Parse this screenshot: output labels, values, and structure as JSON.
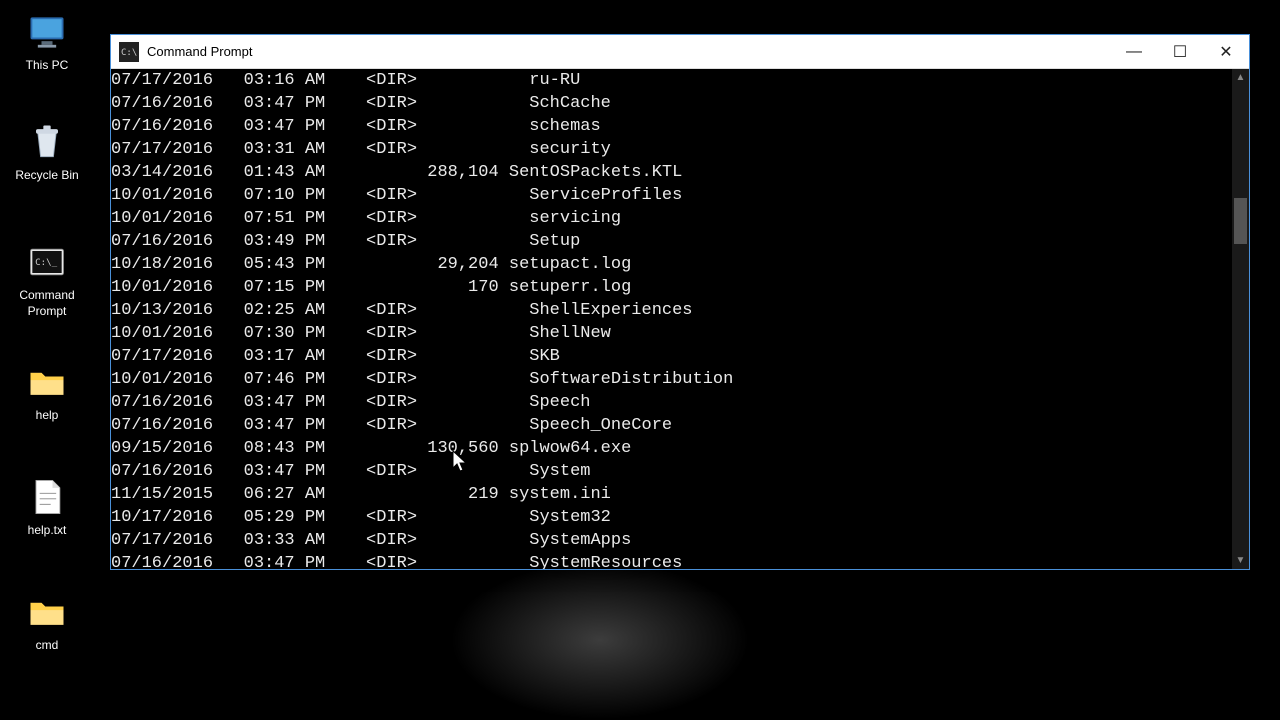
{
  "desktop": {
    "icons": [
      {
        "name": "this-pc",
        "label": "This PC"
      },
      {
        "name": "recycle-bin",
        "label": "Recycle Bin"
      },
      {
        "name": "command-prompt-shortcut",
        "label": "Command Prompt"
      },
      {
        "name": "help-folder",
        "label": "help"
      },
      {
        "name": "help-txt-file",
        "label": "help.txt"
      },
      {
        "name": "cmd-folder",
        "label": "cmd"
      }
    ]
  },
  "window": {
    "title": "Command Prompt",
    "buttons": {
      "min": "—",
      "max": "☐",
      "close": "✕"
    }
  },
  "dir_listing": [
    {
      "date": "07/17/2016",
      "time": "03:16 AM",
      "dir": "<DIR>",
      "size": "",
      "name": "ru-RU"
    },
    {
      "date": "07/16/2016",
      "time": "03:47 PM",
      "dir": "<DIR>",
      "size": "",
      "name": "SchCache"
    },
    {
      "date": "07/16/2016",
      "time": "03:47 PM",
      "dir": "<DIR>",
      "size": "",
      "name": "schemas"
    },
    {
      "date": "07/17/2016",
      "time": "03:31 AM",
      "dir": "<DIR>",
      "size": "",
      "name": "security"
    },
    {
      "date": "03/14/2016",
      "time": "01:43 AM",
      "dir": "",
      "size": "288,104",
      "name": "SentOSPackets.KTL"
    },
    {
      "date": "10/01/2016",
      "time": "07:10 PM",
      "dir": "<DIR>",
      "size": "",
      "name": "ServiceProfiles"
    },
    {
      "date": "10/01/2016",
      "time": "07:51 PM",
      "dir": "<DIR>",
      "size": "",
      "name": "servicing"
    },
    {
      "date": "07/16/2016",
      "time": "03:49 PM",
      "dir": "<DIR>",
      "size": "",
      "name": "Setup"
    },
    {
      "date": "10/18/2016",
      "time": "05:43 PM",
      "dir": "",
      "size": "29,204",
      "name": "setupact.log"
    },
    {
      "date": "10/01/2016",
      "time": "07:15 PM",
      "dir": "",
      "size": "170",
      "name": "setuperr.log"
    },
    {
      "date": "10/13/2016",
      "time": "02:25 AM",
      "dir": "<DIR>",
      "size": "",
      "name": "ShellExperiences"
    },
    {
      "date": "10/01/2016",
      "time": "07:30 PM",
      "dir": "<DIR>",
      "size": "",
      "name": "ShellNew"
    },
    {
      "date": "07/17/2016",
      "time": "03:17 AM",
      "dir": "<DIR>",
      "size": "",
      "name": "SKB"
    },
    {
      "date": "10/01/2016",
      "time": "07:46 PM",
      "dir": "<DIR>",
      "size": "",
      "name": "SoftwareDistribution"
    },
    {
      "date": "07/16/2016",
      "time": "03:47 PM",
      "dir": "<DIR>",
      "size": "",
      "name": "Speech"
    },
    {
      "date": "07/16/2016",
      "time": "03:47 PM",
      "dir": "<DIR>",
      "size": "",
      "name": "Speech_OneCore"
    },
    {
      "date": "09/15/2016",
      "time": "08:43 PM",
      "dir": "",
      "size": "130,560",
      "name": "splwow64.exe"
    },
    {
      "date": "07/16/2016",
      "time": "03:47 PM",
      "dir": "<DIR>",
      "size": "",
      "name": "System"
    },
    {
      "date": "11/15/2015",
      "time": "06:27 AM",
      "dir": "",
      "size": "219",
      "name": "system.ini"
    },
    {
      "date": "10/17/2016",
      "time": "05:29 PM",
      "dir": "<DIR>",
      "size": "",
      "name": "System32"
    },
    {
      "date": "07/17/2016",
      "time": "03:33 AM",
      "dir": "<DIR>",
      "size": "",
      "name": "SystemApps"
    },
    {
      "date": "07/16/2016",
      "time": "03:47 PM",
      "dir": "<DIR>",
      "size": "",
      "name": "SystemResources"
    }
  ]
}
